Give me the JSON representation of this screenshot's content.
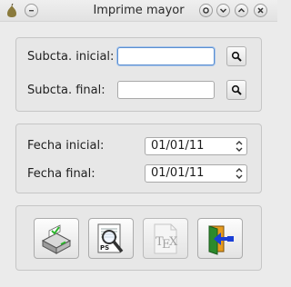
{
  "window": {
    "title": "Imprime mayor"
  },
  "icons": {
    "app": "pear-icon",
    "menu": "window-menu-icon",
    "help": "help-chevron-icon",
    "minimize": "minimize-icon",
    "maximize": "maximize-icon",
    "close": "close-icon",
    "search": "magnifier-icon"
  },
  "accounts": {
    "initial_label": "Subcta. inicial:",
    "initial_value": "",
    "final_label": "Subcta. final:",
    "final_value": ""
  },
  "dates": {
    "initial_label": "Fecha inicial:",
    "initial_value": "01/01/11",
    "final_label": "Fecha final:",
    "final_value": "01/01/11"
  },
  "actions": [
    {
      "name": "print",
      "icon": "printer-icon"
    },
    {
      "name": "postscript-preview",
      "icon": "ps-preview-icon"
    },
    {
      "name": "tex-export",
      "icon": "tex-icon"
    },
    {
      "name": "exit",
      "icon": "exit-door-icon"
    }
  ],
  "colors": {
    "focus": "#5b8fd1",
    "exit_arrow": "#1a3fd6",
    "door": "#e79b1e",
    "printer_check": "#2db52d"
  }
}
